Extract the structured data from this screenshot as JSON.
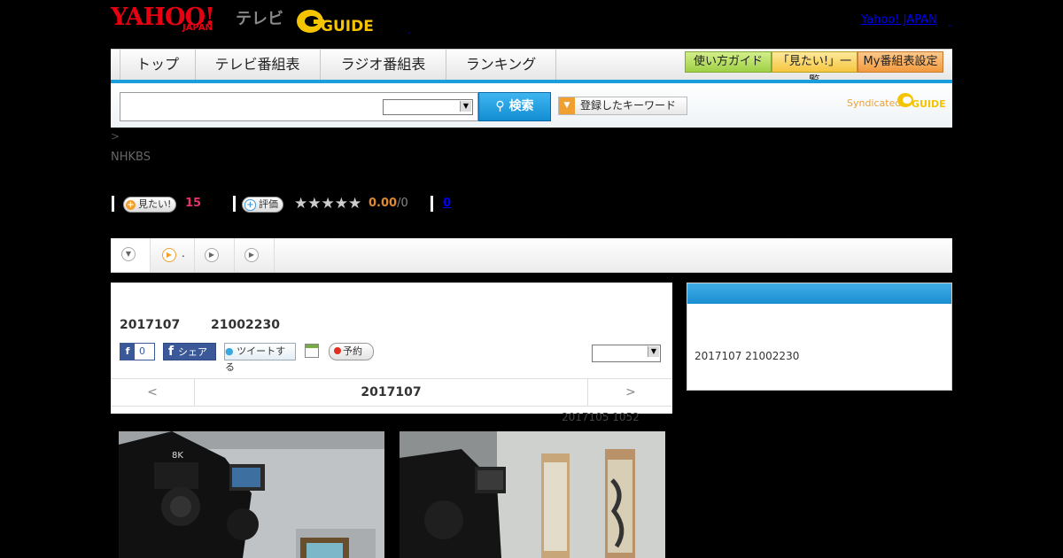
{
  "header": {
    "yahoo_logo": "YAHOO!",
    "yahoo_sub": "JAPAN",
    "tv_label": "テレビ",
    "gguide_logo": "GUIDE",
    "top_link": "Yahoo! JAPAN",
    "top_dot": ".",
    "header_dot": "."
  },
  "nav": {
    "items": [
      "トップ",
      "テレビ番組表",
      "ラジオ番組表",
      "ランキング"
    ],
    "buttons": [
      "使い方ガイド",
      "「見たい!」一覧",
      "My番組表設定"
    ]
  },
  "search": {
    "button_label": "検索",
    "keyword_label": "登録したキーワード",
    "syndicated": "Syndicated",
    "syndicated_logo": "GUIDE"
  },
  "breadcrumb": ">",
  "channel": "NHKBS",
  "stats": {
    "want_label": "見たい!",
    "want_count": "15",
    "rate_label": "評価",
    "stars": "★★★★★",
    "score": "0.00",
    "score_sep": "/0",
    "comments": "0"
  },
  "tabs": {
    "tab2_label": "."
  },
  "program": {
    "date": "2017107",
    "time": "21002230",
    "fb_like_count": "0",
    "fb_share": "シェア",
    "tweet": "ツイートする",
    "reserve": "予約",
    "prev": "<",
    "day": "2017107",
    "next": ">",
    "caption": "2017105  1052"
  },
  "side": {
    "text": "2017107  21002230"
  },
  "colors": {
    "accent_blue": "#1a9ddb",
    "yahoo_red": "#e60012",
    "gguide_yellow": "#f5c400",
    "want_pink": "#e0336a",
    "score_orange": "#e08a30"
  }
}
